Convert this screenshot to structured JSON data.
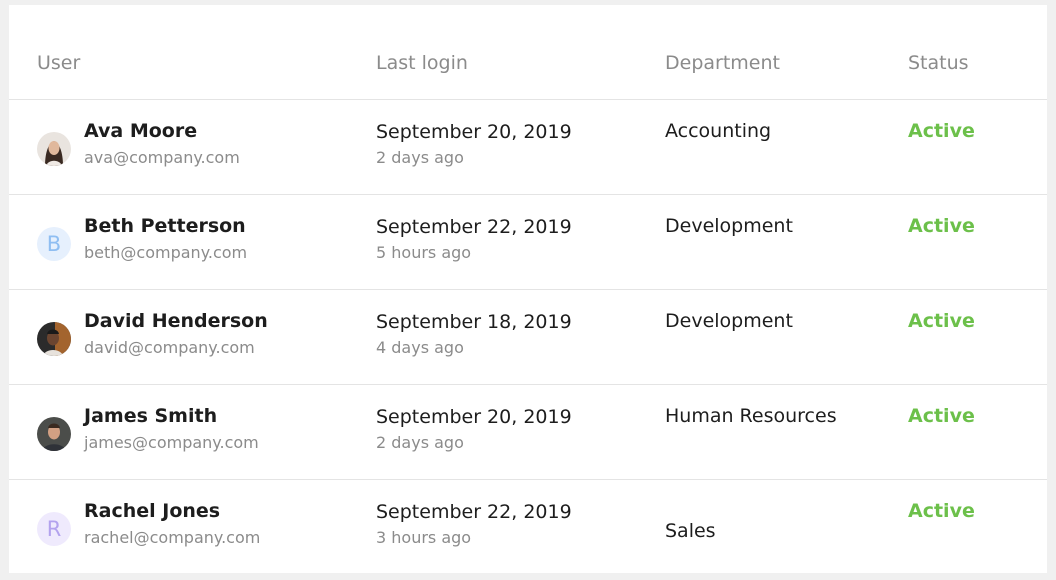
{
  "table": {
    "headers": {
      "user": "User",
      "last_login": "Last login",
      "department": "Department",
      "status": "Status"
    },
    "rows": [
      {
        "name": "Ava Moore",
        "email": "ava@company.com",
        "date": "September 20, 2019",
        "ago": "2 days ago",
        "department": "Accounting",
        "status": "Active",
        "avatar": "photo-avatar"
      },
      {
        "name": "Beth Petterson",
        "email": "beth@company.com",
        "date": "September 22, 2019",
        "ago": "5 hours ago",
        "department": "Development",
        "status": "Active",
        "avatar_initial": "B"
      },
      {
        "name": "David Henderson",
        "email": "david@company.com",
        "date": "September 18, 2019",
        "ago": "4 days ago",
        "department": "Development",
        "status": "Active",
        "avatar": "photo-avatar"
      },
      {
        "name": "James Smith",
        "email": "james@company.com",
        "date": "September 20, 2019",
        "ago": "2 days ago",
        "department": "Human Resources",
        "status": "Active",
        "avatar": "photo-avatar"
      },
      {
        "name": "Rachel Jones",
        "email": "rachel@company.com",
        "date": "September 22, 2019",
        "ago": "3 hours ago",
        "department": "Sales",
        "status": "Active",
        "avatar_initial": "R"
      }
    ]
  },
  "colors": {
    "status_active": "#6cc04a",
    "avatar_b_bg": "#e6f0fd",
    "avatar_b_text": "#8fbef2",
    "avatar_r_bg": "#efeafd",
    "avatar_r_text": "#b3a2ee"
  }
}
